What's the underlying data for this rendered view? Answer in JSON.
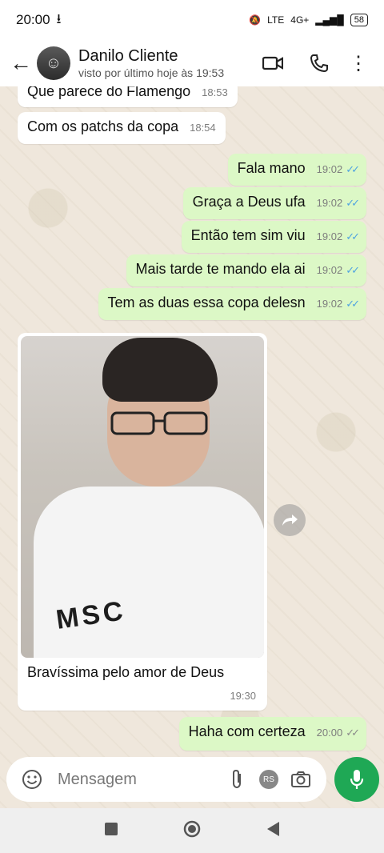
{
  "status_bar": {
    "time": "20:00",
    "network": "4G+",
    "lte": "LTE",
    "battery": "58"
  },
  "header": {
    "contact_name": "Danilo Cliente",
    "last_seen": "visto por último hoje às 19:53"
  },
  "messages": [
    {
      "text": "Que parece do Flamengo",
      "time": "18:53",
      "dir": "in"
    },
    {
      "text": "Com os patchs da copa",
      "time": "18:54",
      "dir": "in"
    },
    {
      "text": "Fala mano",
      "time": "19:02",
      "dir": "out"
    },
    {
      "text": "Graça a Deus ufa",
      "time": "19:02",
      "dir": "out"
    },
    {
      "text": "Então tem sim viu",
      "time": "19:02",
      "dir": "out"
    },
    {
      "text": "Mais tarde te mando ela ai",
      "time": "19:02",
      "dir": "out"
    },
    {
      "text": "Tem as duas essa copa delesn",
      "time": "19:02",
      "dir": "out"
    }
  ],
  "photo_message": {
    "caption": "Bravíssima pelo amor de Deus",
    "time": "19:30",
    "shirt_text": "MSC"
  },
  "last_message": {
    "text": "Haha com certeza",
    "time": "20:00"
  },
  "composer": {
    "placeholder": "Mensagem",
    "rs_label": "RS"
  },
  "colors": {
    "outgoing": "#dcf8c6",
    "incoming": "#ffffff",
    "read_ticks": "#4fa3e0",
    "mic": "#1fa855"
  },
  "icons": [
    "back-arrow-icon",
    "video-call-icon",
    "phone-icon",
    "more-icon",
    "emoji-icon",
    "attach-icon",
    "camera-icon",
    "mic-icon",
    "forward-icon"
  ]
}
